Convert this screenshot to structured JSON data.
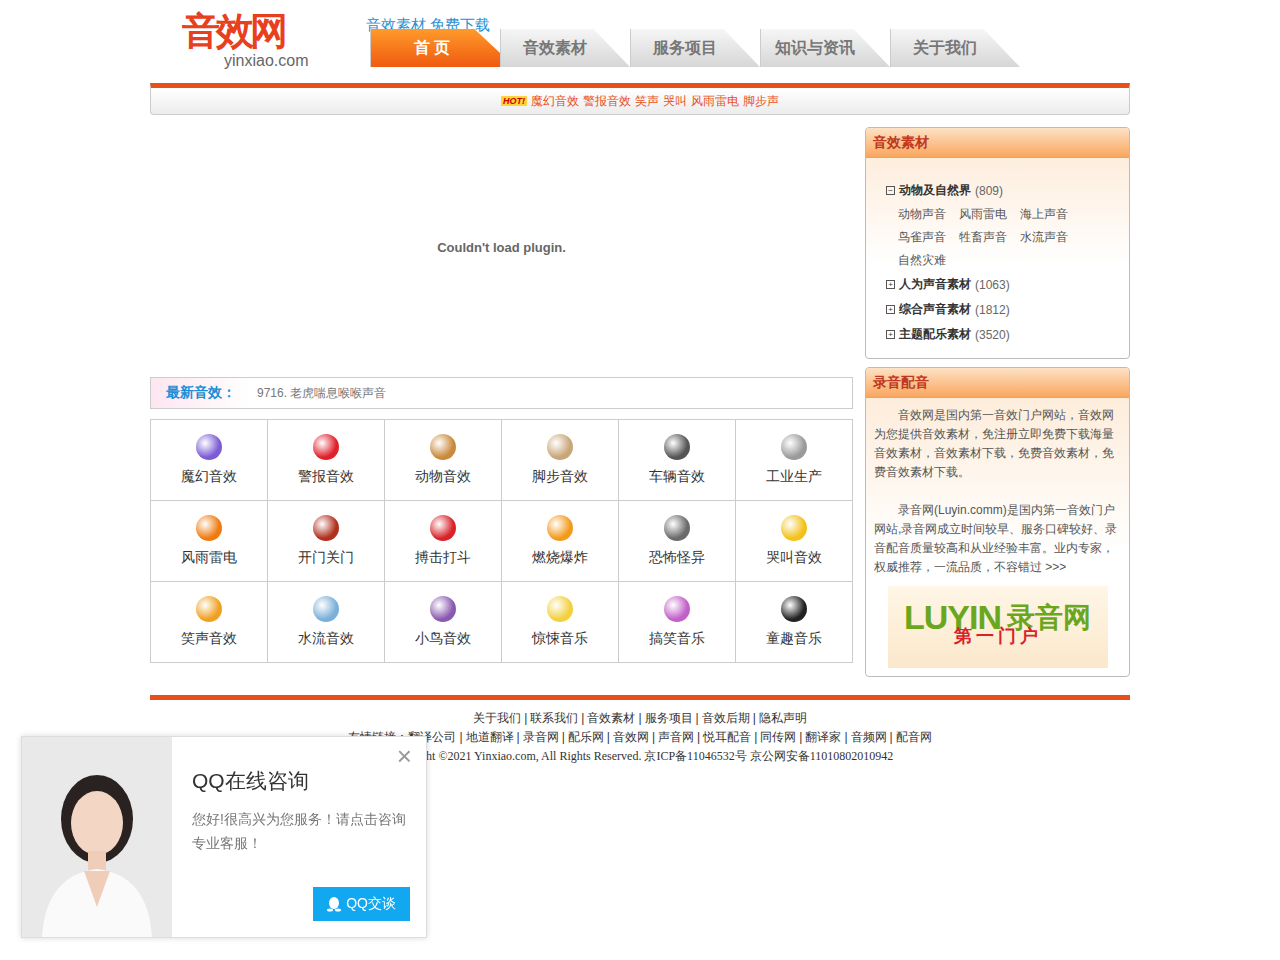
{
  "site": {
    "logo": "音效网",
    "domain": "yinxiao.com",
    "tagline": "音效素材 免费下载"
  },
  "nav": [
    {
      "label": "首 页",
      "selected": true
    },
    {
      "label": "音效素材",
      "selected": false
    },
    {
      "label": "服务项目",
      "selected": false
    },
    {
      "label": "知识与资讯",
      "selected": false
    },
    {
      "label": "关于我们",
      "selected": false
    }
  ],
  "hot": {
    "badge": "HOT!",
    "links": [
      "魔幻音效",
      "警报音效",
      "笑声",
      "哭叫",
      "风雨雷电",
      "脚步声"
    ]
  },
  "player": {
    "message": "Couldn't load plugin."
  },
  "latest": {
    "label": "最新音效：",
    "item": "9716. 老虎喘息喉喉声音"
  },
  "categories": [
    {
      "label": "魔幻音效",
      "color": "#7b5cd6"
    },
    {
      "label": "警报音效",
      "color": "#e0202a"
    },
    {
      "label": "动物音效",
      "color": "#c98a3c"
    },
    {
      "label": "脚步音效",
      "color": "#c9a57a"
    },
    {
      "label": "车辆音效",
      "color": "#555555"
    },
    {
      "label": "工业生产",
      "color": "#9a9a9a"
    },
    {
      "label": "风雨雷电",
      "color": "#f07a10"
    },
    {
      "label": "开门关门",
      "color": "#b0301e"
    },
    {
      "label": "搏击打斗",
      "color": "#d8232a"
    },
    {
      "label": "燃烧爆炸",
      "color": "#f39a1e"
    },
    {
      "label": "恐怖怪异",
      "color": "#6a6a6a"
    },
    {
      "label": "哭叫音效",
      "color": "#f2c21a"
    },
    {
      "label": "笑声音效",
      "color": "#f0a020"
    },
    {
      "label": "水流音效",
      "color": "#7ab0d8"
    },
    {
      "label": "小鸟音效",
      "color": "#8a5ab0"
    },
    {
      "label": "惊悚音乐",
      "color": "#f3d040"
    },
    {
      "label": "搞笑音乐",
      "color": "#c060c8"
    },
    {
      "label": "童趣音乐",
      "color": "#222222"
    }
  ],
  "sidebar": {
    "title": "音效素材",
    "tree": [
      {
        "label": "动物及自然界",
        "count": "(809)",
        "toggle": "−",
        "expanded": true,
        "children": [
          "动物声音",
          "风雨雷电",
          "海上声音",
          "鸟雀声音",
          "牲畜声音",
          "水流声音",
          "自然灾难"
        ]
      },
      {
        "label": "人为声音素材",
        "count": "(1063)",
        "toggle": "+",
        "expanded": false,
        "children": []
      },
      {
        "label": "综合声音素材",
        "count": "(1812)",
        "toggle": "+",
        "expanded": false,
        "children": []
      },
      {
        "label": "主题配乐素材",
        "count": "(3520)",
        "toggle": "+",
        "expanded": false,
        "children": []
      }
    ]
  },
  "promo": {
    "title": "录音配音",
    "paragraphs": [
      "音效网是国内第一音效门户网站，音效网为您提供音效素材，免注册立即免费下载海量音效素材，音效素材下载，免费音效素材，免费音效素材下载。",
      "录音网(Luyin.comm)是国内第一音效门户网站,录音网成立时间较早、服务口碑较好、录音配音质量较高和从业经验丰富。业内专家，权威推荐，一流品质，不容错过 >>>"
    ],
    "banner": {
      "brand": "LUYIN",
      "name": "录音网",
      "slogan": "第一门户"
    }
  },
  "footer": {
    "links": [
      "关于我们",
      "联系我们",
      "音效素材",
      "服务项目",
      "音效后期",
      "隐私声明"
    ],
    "friends_label": "友情链接：",
    "friends": [
      "翻译公司",
      "地道翻译",
      "录音网",
      "配乐网",
      "音效网",
      "声音网",
      "悦耳配音",
      "同传网",
      "翻译家",
      "音频网",
      "配音网"
    ],
    "copyright": "Copyright ©2021 Yinxiao.com, All Rights Reserved. 京ICP备11046532号 京公网安备11010802010942"
  },
  "chat": {
    "title": "QQ在线咨询",
    "message": "您好!很高兴为您服务！请点击咨询专业客服！",
    "button": "QQ交谈",
    "close": "×"
  }
}
